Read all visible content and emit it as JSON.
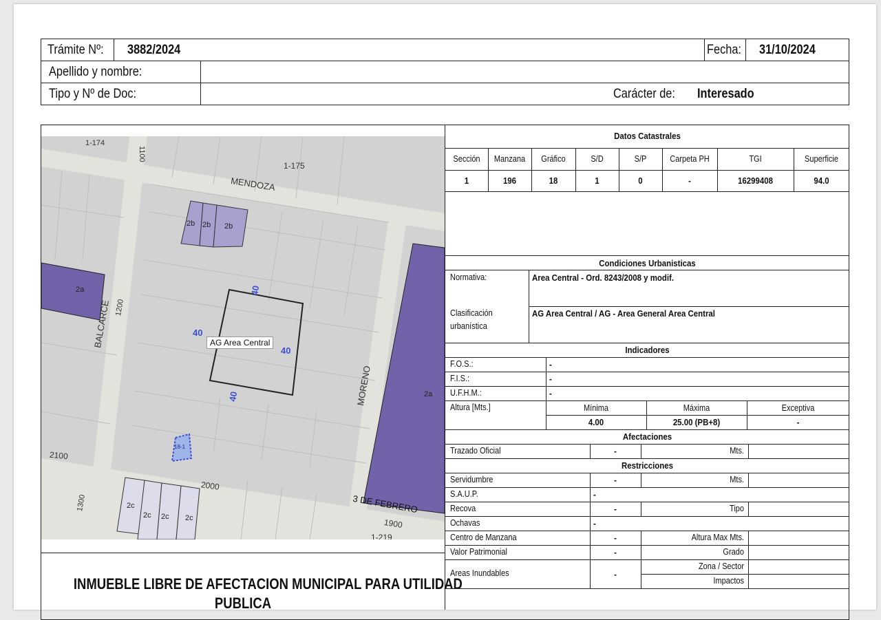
{
  "header": {
    "tramite_label": "Trámite Nº:",
    "tramite_value": "3882/2024",
    "fecha_label": "Fecha:",
    "fecha_value": "31/10/2024",
    "apellido_label": "Apellido y nombre:",
    "tipo_doc_label": "Tipo y Nº de Doc:",
    "caracter_label": "Carácter de:",
    "caracter_value": "Interesado"
  },
  "map": {
    "labels": [
      "1-174",
      "1100",
      "1-175",
      "MENDOZA",
      "2b",
      "2b",
      "2b",
      "2a",
      "BALCARCE",
      "1200",
      "40",
      "40",
      "AG Area Central",
      "40",
      "40",
      "MORENO",
      "2a",
      "2100",
      "1300",
      "2000",
      "2c",
      "2c",
      "2c",
      "2c",
      "3 DE FEBRERO",
      "1900",
      "1-219",
      "18-1"
    ]
  },
  "catastro": {
    "title": "Datos Catastrales",
    "headers": [
      "Sección",
      "Manzana",
      "Gráfico",
      "S/D",
      "S/P",
      "Carpeta PH",
      "TGI",
      "Superficie"
    ],
    "values": [
      "1",
      "196",
      "18",
      "1",
      "0",
      "-",
      "16299408",
      "94.0"
    ]
  },
  "urbanisticas": {
    "title": "Condiciones Urbanisticas",
    "normativa_label": "Normativa:",
    "normativa_value": "Area Central - Ord. 8243/2008 y modif.",
    "clasif_label_1": "Clasificación",
    "clasif_label_2": "urbanística",
    "clasif_value": "AG Area Central / AG - Area General Area Central"
  },
  "indicadores": {
    "title": "Indicadores",
    "fos_label": "F.O.S.:",
    "fos_value": "-",
    "fis_label": "F.I.S.:",
    "fis_value": "-",
    "ufhm_label": "U.F.H.M.:",
    "ufhm_value": "-",
    "altura_label": "Altura [Mts.]",
    "minima_label": "Mínima",
    "maxima_label": "Máxima",
    "excepcional_label": "Exceptiva",
    "minima_value": "4.00",
    "maxima_value": "25.00 (PB+8)",
    "excepcional_value": "-"
  },
  "afectaciones": {
    "title": "Afectaciones",
    "trazado_label": "Trazado Oficial",
    "trazado_value": "-",
    "mts_label": "Mts."
  },
  "restricciones": {
    "title": "Restricciones",
    "servidumbre_label": "Servidumbre",
    "servidumbre_value": "-",
    "servidumbre_unit": "Mts.",
    "saup_label": "S.A.U.P.",
    "saup_value": "-",
    "recova_label": "Recova",
    "recova_value": "-",
    "recova_unit": "Tipo",
    "ochavas_label": "Ochavas",
    "ochavas_value": "-",
    "centro_label": "Centro de Manzana",
    "centro_value": "-",
    "centro_unit": "Altura Max Mts.",
    "valor_label": "Valor Patrimonial",
    "valor_value": "-",
    "valor_unit": "Grado",
    "areas_label": "Areas Inundables",
    "areas_value": "-",
    "zona_label": "Zona / Sector",
    "impactos_label": "Impactos"
  },
  "footer": {
    "line1": "INMUEBLE LIBRE DE AFECTACION MUNICIPAL PARA UTILIDAD",
    "line2": "PUBLICA"
  },
  "colors": {
    "zone_2a": "#7262aa",
    "zone_2b": "#a6a1cf",
    "zone_2c": "#dcdcea",
    "map_bg": "#d2d2d2",
    "street": "#e4e2dc",
    "parcel_mark": "#3b4fd4"
  }
}
